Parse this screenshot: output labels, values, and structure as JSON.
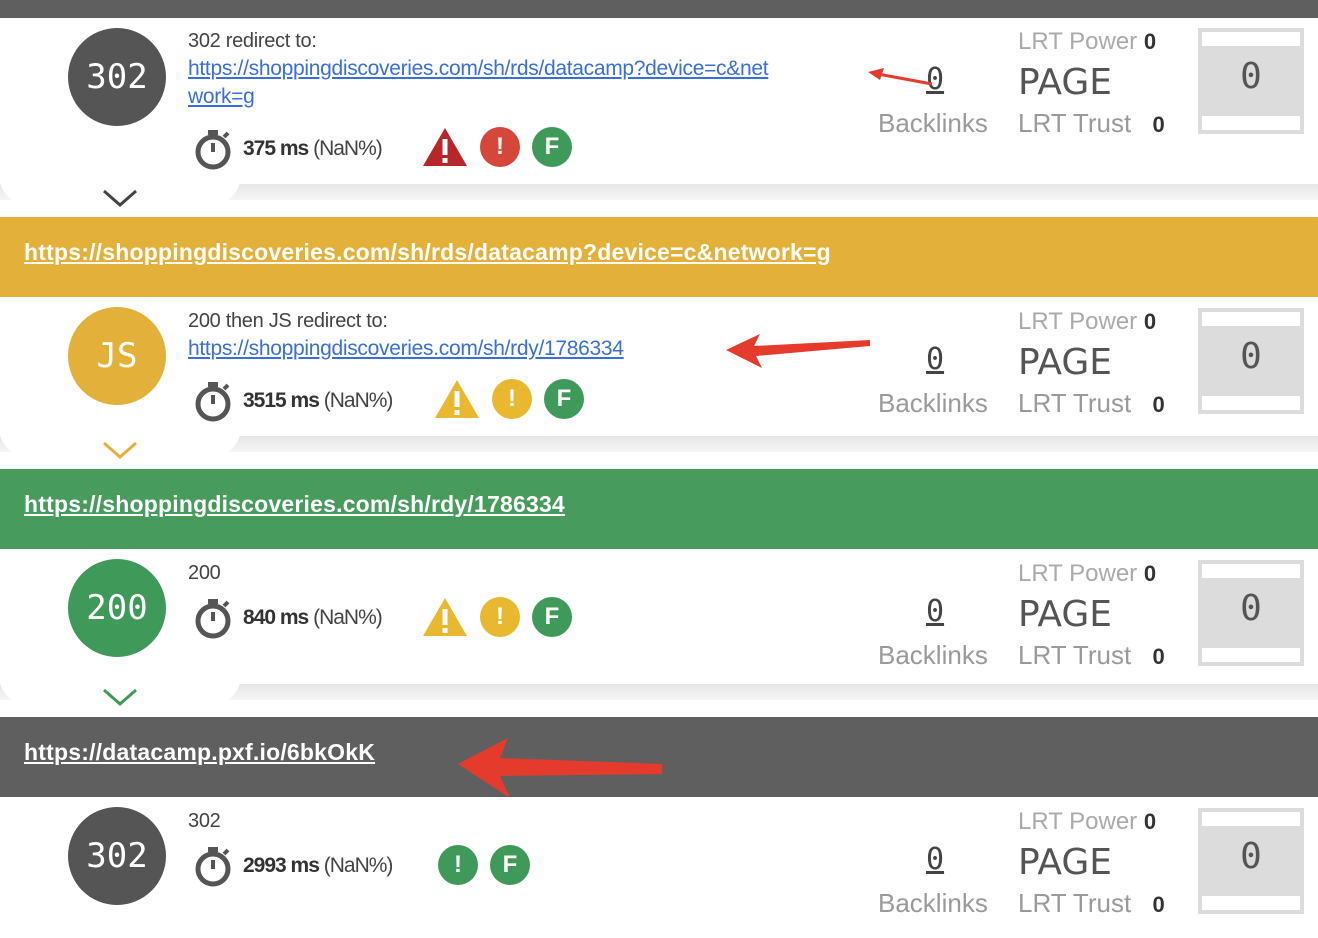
{
  "steps": [
    {
      "code": "302",
      "circle_color": "#555555",
      "status": "302 redirect to:",
      "url": "https://shoppingdiscoveries.com/sh/rds/datacamp?device=c&network=g",
      "url_line1": "https://shoppingdiscoveries.com/sh/rds/datacamp?device=c&net",
      "url_line2": "work=g",
      "ms": "375 ms",
      "pct": "(NaN%)",
      "badges": [
        "warning-red",
        "info-red",
        "F-green"
      ],
      "backlinks": "0",
      "backlinks_label": "Backlinks",
      "lrt_power_label": "LRT Power",
      "lrt_power": "0",
      "page_label": "PAGE",
      "lrt_trust_label": "LRT Trust",
      "lrt_trust": "0",
      "gauge": "0"
    },
    {
      "code": "JS",
      "circle_color": "#e3b13a",
      "status": "200 then JS redirect to:",
      "url": "https://shoppingdiscoveries.com/sh/rdy/1786334",
      "ms": "3515 ms",
      "pct": "(NaN%)",
      "badges": [
        "warning-yellow",
        "info-yellow",
        "F-green"
      ],
      "backlinks": "0",
      "backlinks_label": "Backlinks",
      "lrt_power_label": "LRT Power",
      "lrt_power": "0",
      "page_label": "PAGE",
      "lrt_trust_label": "LRT Trust",
      "lrt_trust": "0",
      "gauge": "0"
    },
    {
      "code": "200",
      "circle_color": "#3f9a59",
      "status": "200",
      "ms": "840 ms",
      "pct": "(NaN%)",
      "badges": [
        "warning-yellow",
        "info-yellow",
        "F-green"
      ],
      "backlinks": "0",
      "backlinks_label": "Backlinks",
      "lrt_power_label": "LRT Power",
      "lrt_power": "0",
      "page_label": "PAGE",
      "lrt_trust_label": "LRT Trust",
      "lrt_trust": "0",
      "gauge": "0"
    },
    {
      "code": "302",
      "circle_color": "#555555",
      "status": "302",
      "ms": "2993 ms",
      "pct": "(NaN%)",
      "badges": [
        "info-green",
        "F-green"
      ],
      "backlinks": "0",
      "backlinks_label": "Backlinks",
      "lrt_power_label": "LRT Power",
      "lrt_power": "0",
      "page_label": "PAGE",
      "lrt_trust_label": "LRT Trust",
      "lrt_trust": "0",
      "gauge": "0"
    }
  ],
  "bands": [
    {
      "url": "https://shoppingdiscoveries.com/sh/rds/datacamp?device=c&network=g",
      "color": "#e3b13a"
    },
    {
      "url": "https://shoppingdiscoveries.com/sh/rdy/1786334",
      "color": "#479b5c"
    },
    {
      "url": "https://datacamp.pxf.io/6bkOkK",
      "color": "#5f5f5f"
    }
  ],
  "badge_glyphs": {
    "info": "!",
    "F": "F"
  },
  "colors": {
    "red_arrow": "#e53b2c",
    "link": "#3a6fd8"
  }
}
